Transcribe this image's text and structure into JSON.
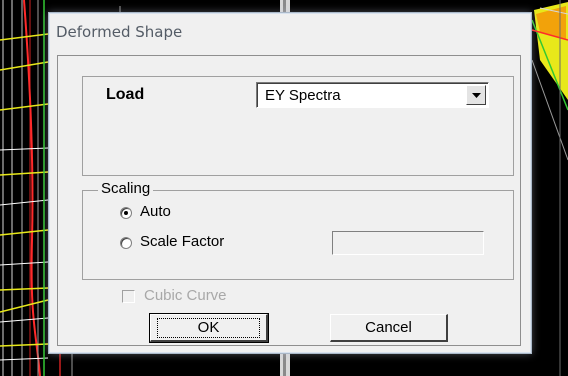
{
  "dialog": {
    "title": "Deformed Shape",
    "load": {
      "label": "Load",
      "selected": "EY Spectra"
    },
    "scaling": {
      "legend": "Scaling",
      "auto_label": "Auto",
      "scale_factor_label": "Scale Factor",
      "scale_factor_value": "",
      "selected": "Auto"
    },
    "cubic_curve": {
      "label": "Cubic Curve",
      "checked": false,
      "enabled": false
    },
    "buttons": {
      "ok": "OK",
      "cancel": "Cancel"
    }
  },
  "colors": {
    "background": "#000000",
    "dialog_face": "#f0f0f0",
    "disabled_text": "#a8a8a8",
    "title_text": "#545c66"
  },
  "icons": {
    "dropdown": "chevron-down-icon",
    "radio_selected": "radio-selected-icon",
    "radio_unselected": "radio-unselected-icon"
  }
}
